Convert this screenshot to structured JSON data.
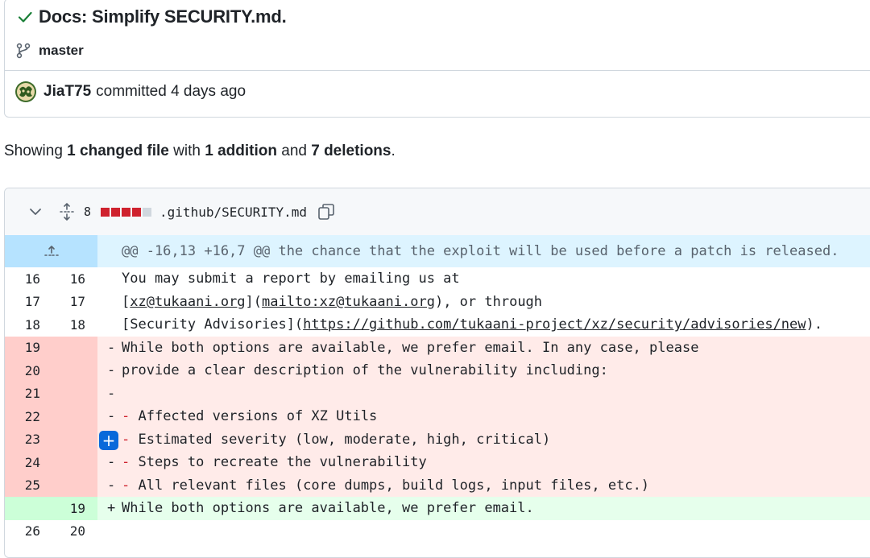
{
  "commit": {
    "title": "Docs: Simplify SECURITY.md.",
    "branch": "master",
    "author": "JiaT75",
    "meta": "committed 4 days ago"
  },
  "summary": {
    "prefix": "Showing ",
    "changed": "1 changed file",
    "with": " with ",
    "additions": "1 addition",
    "and": " and ",
    "deletions": "7 deletions",
    "end": "."
  },
  "file": {
    "count": "8",
    "diffstat": [
      "del",
      "del",
      "del",
      "del",
      "neutral"
    ],
    "path": ".github/SECURITY.md"
  },
  "diff": {
    "hunk": "@@ -16,13 +16,7 @@ the chance that the exploit will be used before a patch is released.",
    "lines": [
      {
        "type": "ctx",
        "old": "16",
        "new": "16",
        "marker": "",
        "text": "You may submit a report by emailing us at"
      },
      {
        "type": "ctx",
        "old": "17",
        "new": "17",
        "marker": "",
        "text_pre": "[xz@tukaani.org](",
        "link1": "xz@tukaani.org",
        "link2": "mailto:xz@tukaani.org",
        "text_post": "), or through"
      },
      {
        "type": "ctx",
        "old": "18",
        "new": "18",
        "marker": "",
        "text_pre": "[Security Advisories](",
        "link": "https://github.com/tukaani-project/xz/security/advisories/new",
        "text_post": ")."
      },
      {
        "type": "del",
        "old": "19",
        "new": "",
        "marker": "-",
        "text": "While both options are available, we prefer email. In any case, please"
      },
      {
        "type": "del",
        "old": "20",
        "new": "",
        "marker": "-",
        "text": "provide a clear description of the vulnerability including:"
      },
      {
        "type": "del",
        "old": "21",
        "new": "",
        "marker": "-",
        "text": ""
      },
      {
        "type": "del",
        "old": "22",
        "new": "",
        "marker": "-",
        "text": "- Affected versions of XZ Utils"
      },
      {
        "type": "del",
        "old": "23",
        "new": "",
        "marker": "-",
        "text": "- Estimated severity (low, moderate, high, critical)"
      },
      {
        "type": "del",
        "old": "24",
        "new": "",
        "marker": "-",
        "text": "- Steps to recreate the vulnerability"
      },
      {
        "type": "del",
        "old": "25",
        "new": "",
        "marker": "-",
        "text": "- All relevant files (core dumps, build logs, input files, etc.)"
      },
      {
        "type": "add",
        "old": "",
        "new": "19",
        "marker": "+",
        "text": "While both options are available, we prefer email."
      },
      {
        "type": "ctx",
        "old": "26",
        "new": "20",
        "marker": "",
        "text": ""
      }
    ],
    "add_comment_label": "+"
  },
  "colors": {
    "accent": "#0969da",
    "success": "#1a7f37",
    "danger": "#cf222e",
    "del_bg": "#ffebe9",
    "add_bg": "#e6ffec",
    "hunk_bg": "#ddf4ff"
  },
  "icons": [
    "check-icon",
    "git-branch-icon",
    "avatar",
    "chevron-down-icon",
    "unfold-icon",
    "copy-icon",
    "fold-up-icon",
    "plus-icon"
  ]
}
